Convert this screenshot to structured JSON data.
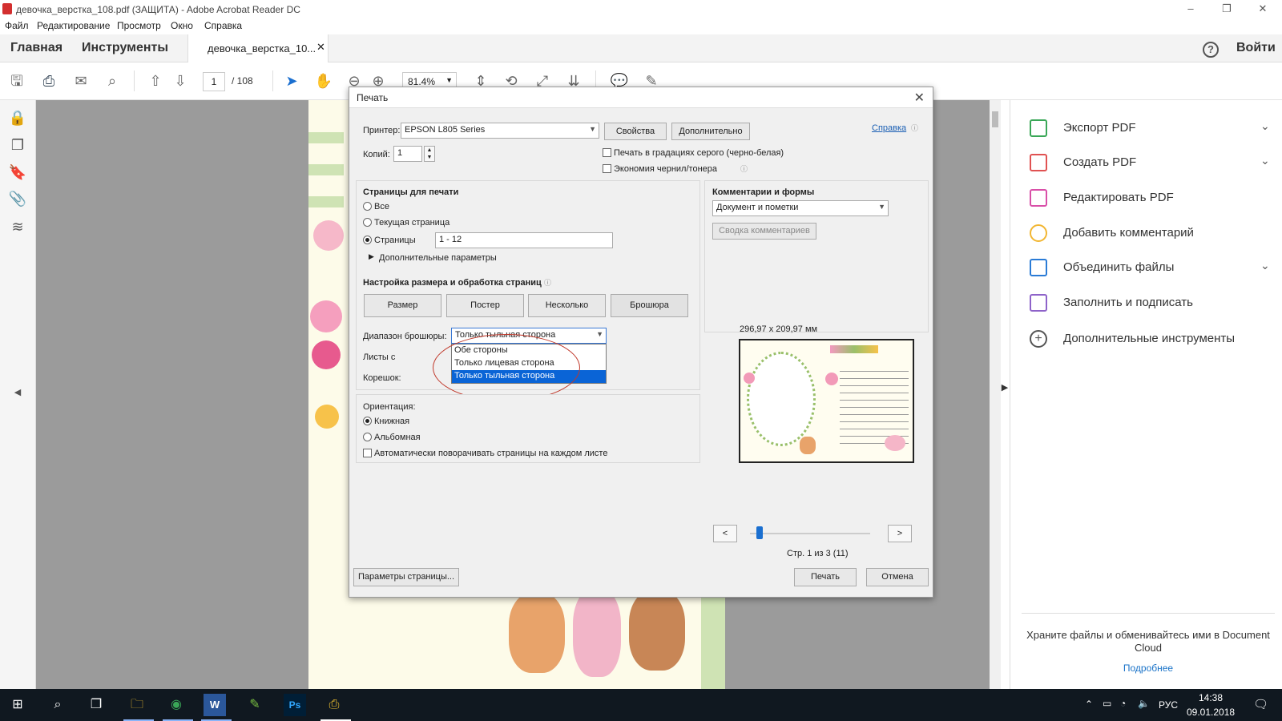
{
  "window": {
    "title": "девочка_верстка_108.pdf (ЗАЩИТА) - Adobe Acrobat Reader DC"
  },
  "menu": [
    "Файл",
    "Редактирование",
    "Просмотр",
    "Окно",
    "Справка"
  ],
  "tabs": {
    "home": "Главная",
    "tools": "Инструменты",
    "doc_tab": "девочка_верстка_10...",
    "login": "Войти"
  },
  "toolbar": {
    "page_current": "1",
    "page_total": "/ 108",
    "zoom": "81.4%"
  },
  "right_panel": {
    "items": [
      {
        "label": "Экспорт PDF",
        "icon": "export-pdf-icon",
        "color": "#3aa757"
      },
      {
        "label": "Создать PDF",
        "icon": "create-pdf-icon",
        "color": "#e05252"
      },
      {
        "label": "Редактировать PDF",
        "icon": "edit-pdf-icon",
        "color": "#d94fa8"
      },
      {
        "label": "Добавить комментарий",
        "icon": "comment-icon",
        "color": "#f2b632"
      },
      {
        "label": "Объединить файлы",
        "icon": "combine-icon",
        "color": "#2a7bd6"
      },
      {
        "label": "Заполнить и подписать",
        "icon": "fill-sign-icon",
        "color": "#8e63c9"
      },
      {
        "label": "Дополнительные инструменты",
        "icon": "more-tools-icon",
        "color": "#555555"
      }
    ],
    "cloud_text": "Храните файлы и обменивайтесь ими в Document Cloud",
    "cloud_more": "Подробнее"
  },
  "dialog": {
    "title": "Печать",
    "printer_label": "Принтер:",
    "printer_value": "EPSON L805 Series",
    "properties_btn": "Свойства",
    "advanced_btn": "Дополнительно",
    "help_link": "Справка",
    "copies_label": "Копий:",
    "copies_value": "1",
    "grayscale_label": "Печать в градациях серого (черно-белая)",
    "save_ink_label": "Экономия чернил/тонера",
    "pages_heading": "Страницы для печати",
    "pages_all": "Все",
    "pages_current": "Текущая страница",
    "pages_range": "Страницы",
    "pages_range_value": "1 - 12",
    "more_options": "Дополнительные параметры",
    "comments_heading": "Комментарии и формы",
    "comments_value": "Документ и пометки",
    "comments_summary_btn": "Сводка комментариев",
    "sizing_heading": "Настройка размера и обработка страниц",
    "size_btn": "Размер",
    "poster_btn": "Постер",
    "multiple_btn": "Несколько",
    "booklet_btn": "Брошюра",
    "booklet_range_label": "Диапазон брошюры:",
    "booklet_range_value": "Только тыльная сторона",
    "sheets_label": "Листы с",
    "binding_label": "Корешок:",
    "dropdown_options": [
      "Обе стороны",
      "Только лицевая сторона",
      "Только тыльная сторона"
    ],
    "orientation_label": "Ориентация:",
    "portrait": "Книжная",
    "landscape": "Альбомная",
    "auto_rotate": "Автоматически поворачивать страницы на каждом листе",
    "preview_size": "296,97 x 209,97 мм",
    "prev_btn": "<",
    "next_btn": ">",
    "page_info": "Стр. 1 из 3 (11)",
    "page_setup_btn": "Параметры страницы...",
    "print_btn": "Печать",
    "cancel_btn": "Отмена"
  },
  "taskbar": {
    "lang": "РУС",
    "time": "14:38",
    "date": "09.01.2018"
  }
}
